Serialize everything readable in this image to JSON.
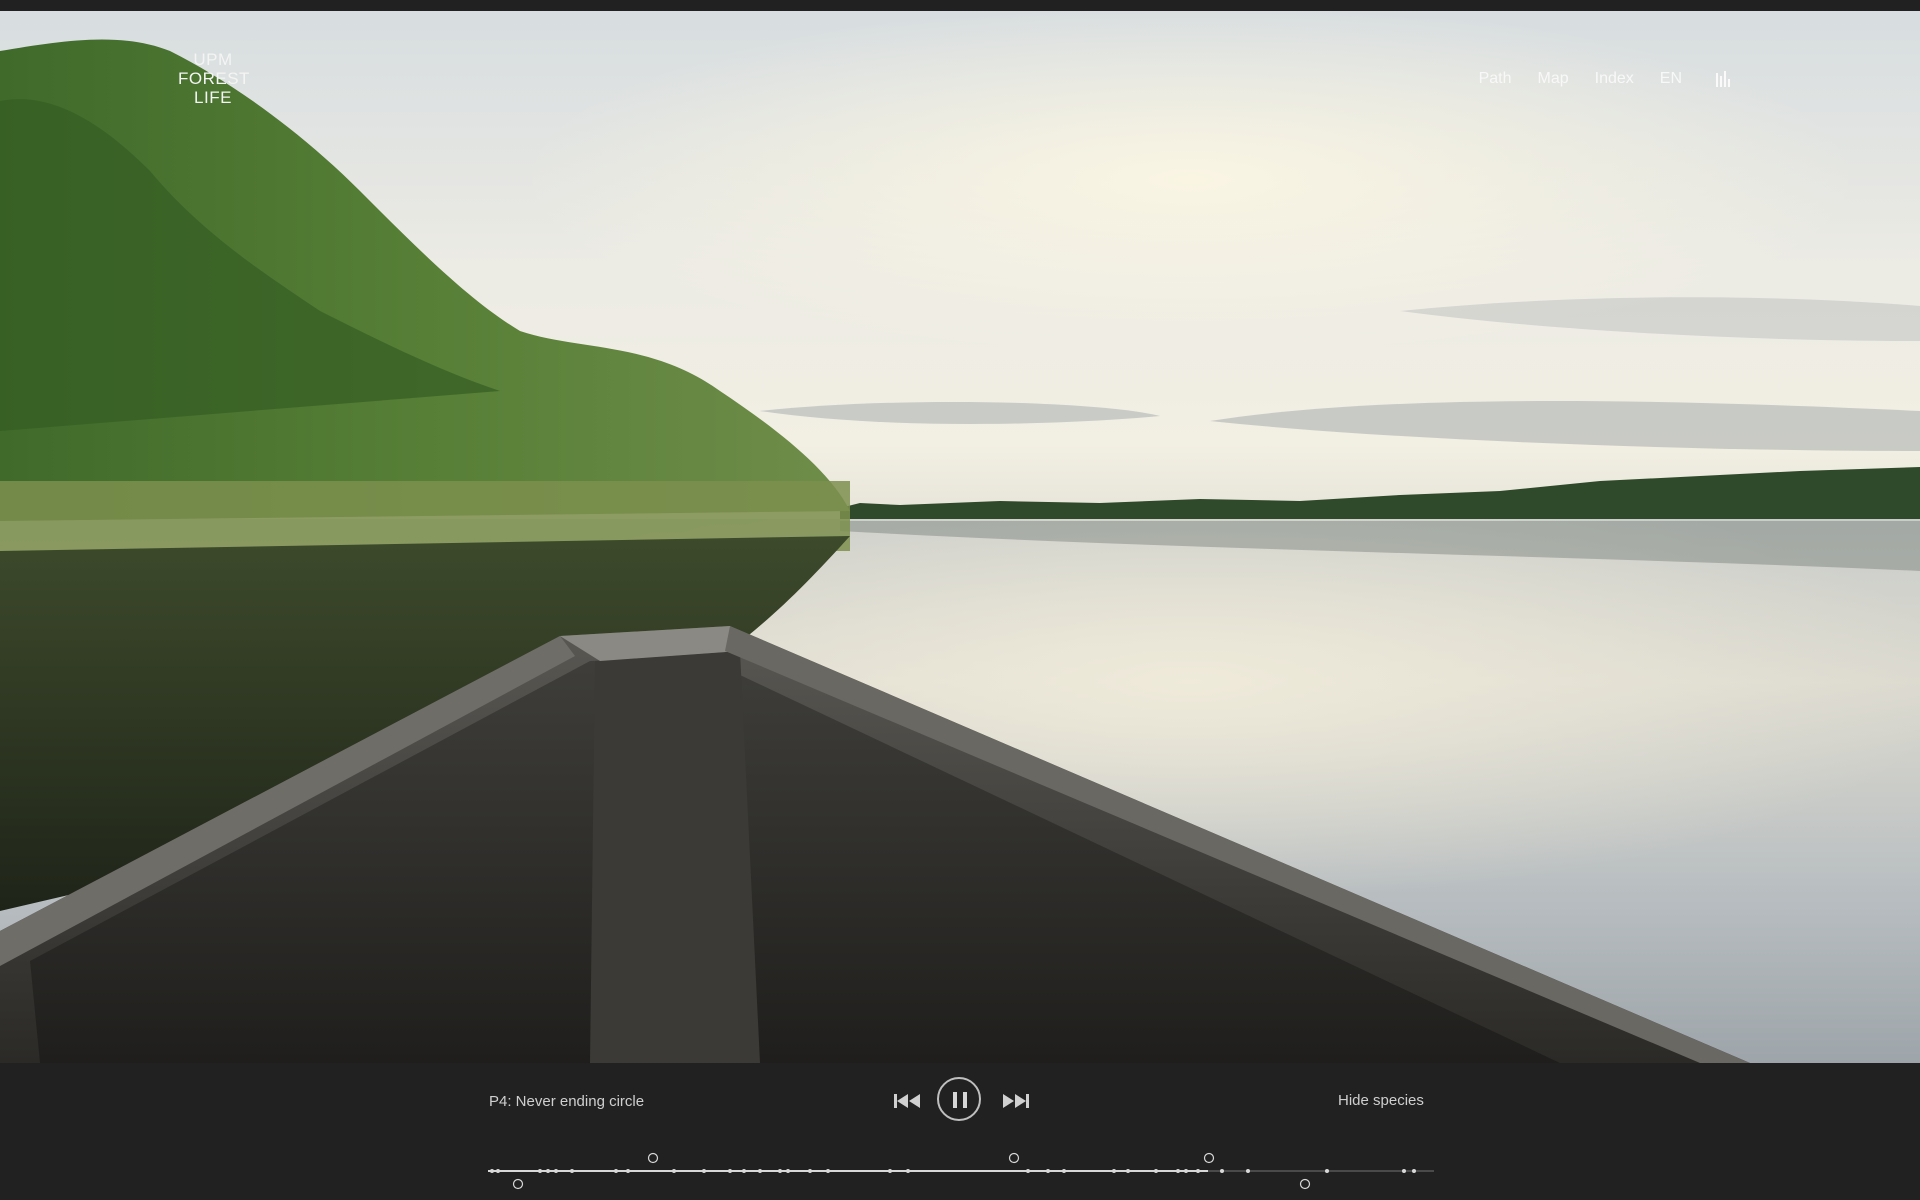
{
  "brand": {
    "logo_lines": [
      "UPM",
      "FOREST",
      "LIFE"
    ]
  },
  "nav": {
    "items": [
      "Path",
      "Map",
      "Index",
      "EN"
    ],
    "audio_icon": "sound-bars-icon"
  },
  "player": {
    "track_title": "P4: Never ending circle",
    "hide_species_label": "Hide species",
    "prev_icon": "skip-previous-icon",
    "pause_icon": "pause-icon",
    "next_icon": "skip-next-icon",
    "state": "playing"
  },
  "colors": {
    "background": "#212121",
    "control_text": "#cfcfcf",
    "nav_text": "#fafafa"
  }
}
